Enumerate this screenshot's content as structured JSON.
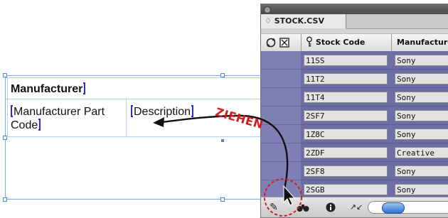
{
  "layout_frame": {
    "header_cell": "Manufacturer",
    "row2_cell1": [
      "Manufacturer Part",
      "Code"
    ],
    "row2_cell2": "Description"
  },
  "annotation": {
    "drag_label": "ZIEHEN",
    "color": "#d21c1c"
  },
  "panel": {
    "tab_label": "♢ STOCK.CSV",
    "columns": [
      {
        "label": "Stock Code",
        "icon": "key-icon"
      },
      {
        "label": "Manufacture",
        "icon": ""
      }
    ],
    "header_icons": [
      "refresh-icon",
      "checkbox-x-icon"
    ],
    "rows": [
      {
        "code": "11SS",
        "manufacturer": "Sony"
      },
      {
        "code": "11T2",
        "manufacturer": "Sony"
      },
      {
        "code": "11T4",
        "manufacturer": "Sony"
      },
      {
        "code": "2SF7",
        "manufacturer": "Sony"
      },
      {
        "code": "1Z8C",
        "manufacturer": "Sony"
      },
      {
        "code": "2ZDF",
        "manufacturer": "Creative"
      },
      {
        "code": "2SF8",
        "manufacturer": "Sony"
      },
      {
        "code": "2SGB",
        "manufacturer": "Sony"
      }
    ],
    "footer_icons": [
      "pen-icon",
      "binoculars-icon",
      "info-icon",
      "arrows-icon",
      "toggle-pill-icon"
    ],
    "colors": {
      "selection": "#7f7fb6",
      "highlight_text": "#2b2bd8"
    }
  }
}
